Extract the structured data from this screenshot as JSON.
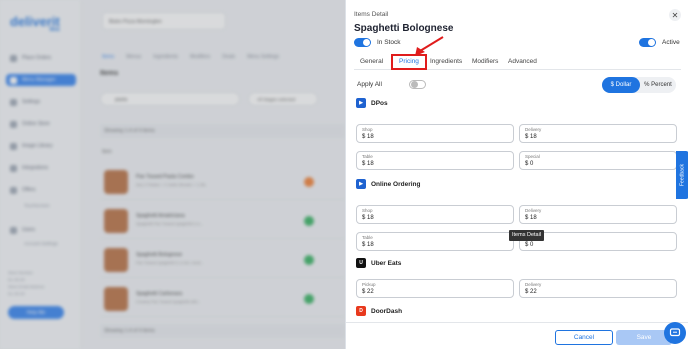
{
  "background": {
    "logo": "deliverit",
    "logo_sub": "Web",
    "nav": [
      "Place Orders",
      "Menu Manager",
      "Settings",
      "Online Store",
      "Image Library",
      "Integrations",
      "Offers",
      "Users"
    ],
    "nav_sub": [
      "Touchscreen",
      "Account Settings"
    ],
    "footer_lines": [
      "Store Number",
      "DL-00-00",
      "Store Email Address",
      "DL-00-00"
    ],
    "help_label": "Help Me",
    "store_select": "Bistro Pizza Morningten",
    "tabs": [
      "Items",
      "Menus",
      "Ingredients",
      "Modifiers",
      "Deals",
      "Menu Settings"
    ],
    "heading": "Items",
    "search_value": "pasta",
    "filter_label": "All Stages selected",
    "showing_top": "Showing 1-4 of 4 items",
    "list_header": "Item",
    "rows": [
      {
        "title": "Pan Tossed Pasta Combo",
        "desc": "Any 2 Pastas + 2 Garlic Breads + 1.25L",
        "status": "orange"
      },
      {
        "title": "Spaghetti Amatriciana",
        "desc": "Spaghetti Pan Tossed spaghetti in a...",
        "status": "green"
      },
      {
        "title": "Spaghetti Bolognese",
        "desc": "Pan Tossed spaghetti in a rich, meat...",
        "status": "green"
      },
      {
        "title": "Spaghetti Carbonara",
        "desc": "Creamy Pan Tossed spaghetti with...",
        "status": "green"
      }
    ],
    "showing_bottom": "Showing 1-4 of 4 items"
  },
  "panel": {
    "label": "Items Detail",
    "title": "Spaghetti Bolognese",
    "in_stock_label": "In Stock",
    "active_label": "Active",
    "tabs": [
      "General",
      "Pricing",
      "Ingredients",
      "Modifiers",
      "Advanced"
    ],
    "active_tab": "Pricing",
    "apply_all_label": "Apply All",
    "dollar_label": "$ Dollar",
    "percent_label": "% Percent",
    "sections": [
      {
        "name": "DPos",
        "fields": [
          {
            "label": "Shop",
            "value": "$ 18"
          },
          {
            "label": "Delivery",
            "value": "$ 18"
          },
          {
            "label": "Table",
            "value": "$ 18"
          },
          {
            "label": "Special",
            "value": "$ 0"
          }
        ]
      },
      {
        "name": "Online Ordering",
        "fields": [
          {
            "label": "Shop",
            "value": "$ 18"
          },
          {
            "label": "Delivery",
            "value": "$ 18"
          },
          {
            "label": "Table",
            "value": "$ 18"
          },
          {
            "label": "Special",
            "value": "$ 0"
          }
        ]
      },
      {
        "name": "Uber Eats",
        "fields": [
          {
            "label": "Pickup",
            "value": "$ 22"
          },
          {
            "label": "Delivery",
            "value": "$ 22"
          }
        ]
      },
      {
        "name": "DoorDash",
        "fields": []
      }
    ],
    "tooltip": "Items Detail",
    "feedback_label": "Feedback",
    "cancel_label": "Cancel",
    "save_label": "Save"
  },
  "colors": {
    "accent": "#1f74e0",
    "highlight": "#e01c1c"
  }
}
